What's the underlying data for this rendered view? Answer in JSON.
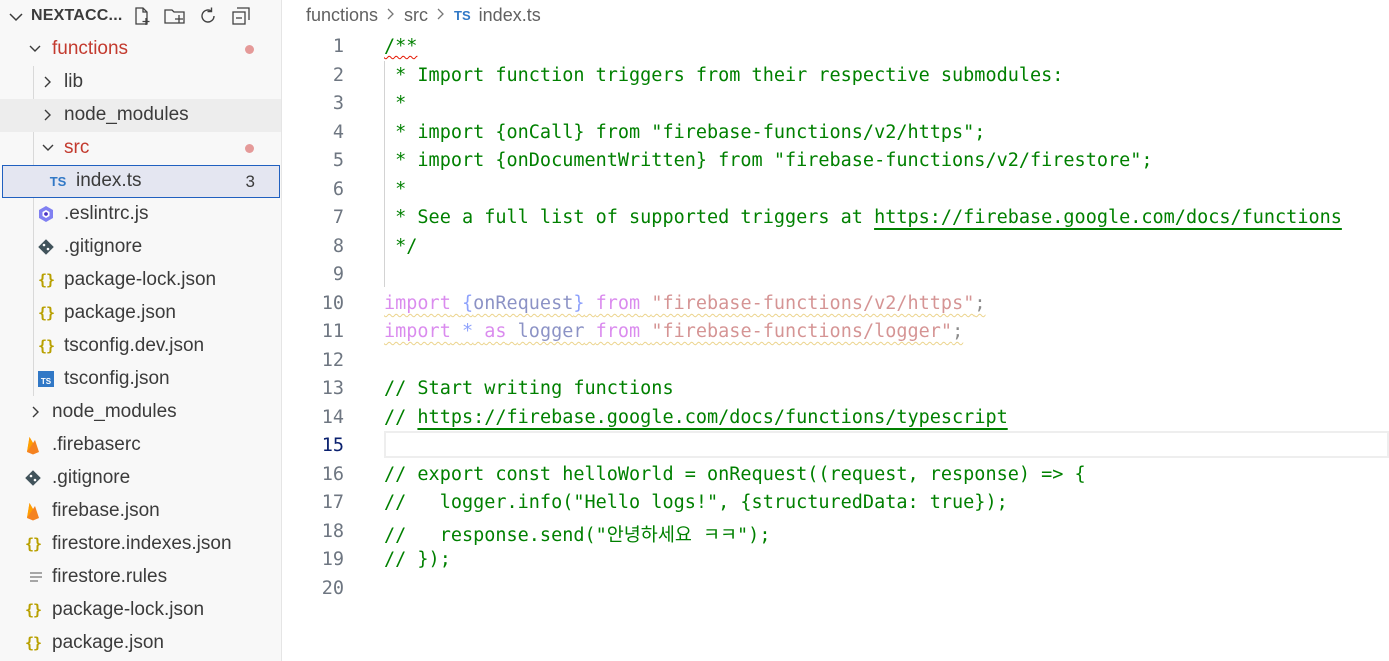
{
  "explorer": {
    "title": "NEXTACC...",
    "actions": [
      "new-file-icon",
      "new-folder-icon",
      "refresh-icon",
      "collapse-all-icon"
    ],
    "items": [
      {
        "label": "functions",
        "kind": "folder-open",
        "modified": true
      },
      {
        "label": "lib",
        "kind": "folder"
      },
      {
        "label": "node_modules",
        "kind": "folder"
      },
      {
        "label": "src",
        "kind": "folder-open",
        "modified": true
      },
      {
        "label": "index.ts",
        "kind": "ts",
        "badge": "3"
      },
      {
        "label": ".eslintrc.js",
        "kind": "eslint"
      },
      {
        "label": ".gitignore",
        "kind": "git"
      },
      {
        "label": "package-lock.json",
        "kind": "json"
      },
      {
        "label": "package.json",
        "kind": "json"
      },
      {
        "label": "tsconfig.dev.json",
        "kind": "json"
      },
      {
        "label": "tsconfig.json",
        "kind": "tsconfig"
      },
      {
        "label": "node_modules",
        "kind": "folder"
      },
      {
        "label": ".firebaserc",
        "kind": "firebase"
      },
      {
        "label": ".gitignore",
        "kind": "git"
      },
      {
        "label": "firebase.json",
        "kind": "firebase"
      },
      {
        "label": "firestore.indexes.json",
        "kind": "json"
      },
      {
        "label": "firestore.rules",
        "kind": "rules"
      },
      {
        "label": "package-lock.json",
        "kind": "json"
      },
      {
        "label": "package.json",
        "kind": "json"
      }
    ]
  },
  "breadcrumb": {
    "parts": [
      "functions",
      "src",
      "index.ts"
    ],
    "file_icon": "TS"
  },
  "editor": {
    "active_line": "15",
    "line_numbers": [
      "1",
      "2",
      "3",
      "4",
      "5",
      "6",
      "7",
      "8",
      "9",
      "10",
      "11",
      "12",
      "13",
      "14",
      "15",
      "16",
      "17",
      "18",
      "19",
      "20"
    ],
    "lines": {
      "l1": "/**",
      "l2": " * Import function triggers from their respective submodules:",
      "l3": " *",
      "l4": " * import {onCall} from \"firebase-functions/v2/https\";",
      "l5": " * import {onDocumentWritten} from \"firebase-functions/v2/firestore\";",
      "l6": " *",
      "l7a": " * See a full list of supported triggers at ",
      "l7b": "https://firebase.google.com/docs/functions",
      "l8": " */",
      "l10": {
        "kw1": "import",
        "brace_open": "{",
        "name": "onRequest",
        "brace_close": "}",
        "kw2": "from",
        "str": "\"firebase-functions/v2/https\"",
        "semi": ";"
      },
      "l11": {
        "kw1": "import",
        "star": "*",
        "kw_as": "as",
        "name": "logger",
        "kw2": "from",
        "str": "\"firebase-functions/logger\"",
        "semi": ";"
      },
      "l13": "// Start writing functions",
      "l14a": "// ",
      "l14b": "https://firebase.google.com/docs/functions/typescript",
      "l16": "// export const helloWorld = onRequest((request, response) => {",
      "l17": "//   logger.info(\"Hello logs!\", {structuredData: true});",
      "l18": "//   response.send(\"안녕하세요 ㅋㅋ\");",
      "l19": "// });"
    }
  },
  "colors": {
    "comment": "#008000",
    "keyword": "#af00db",
    "string": "#a31515",
    "modified_dot": "#e59a99",
    "ts_blue": "#3178c6"
  }
}
